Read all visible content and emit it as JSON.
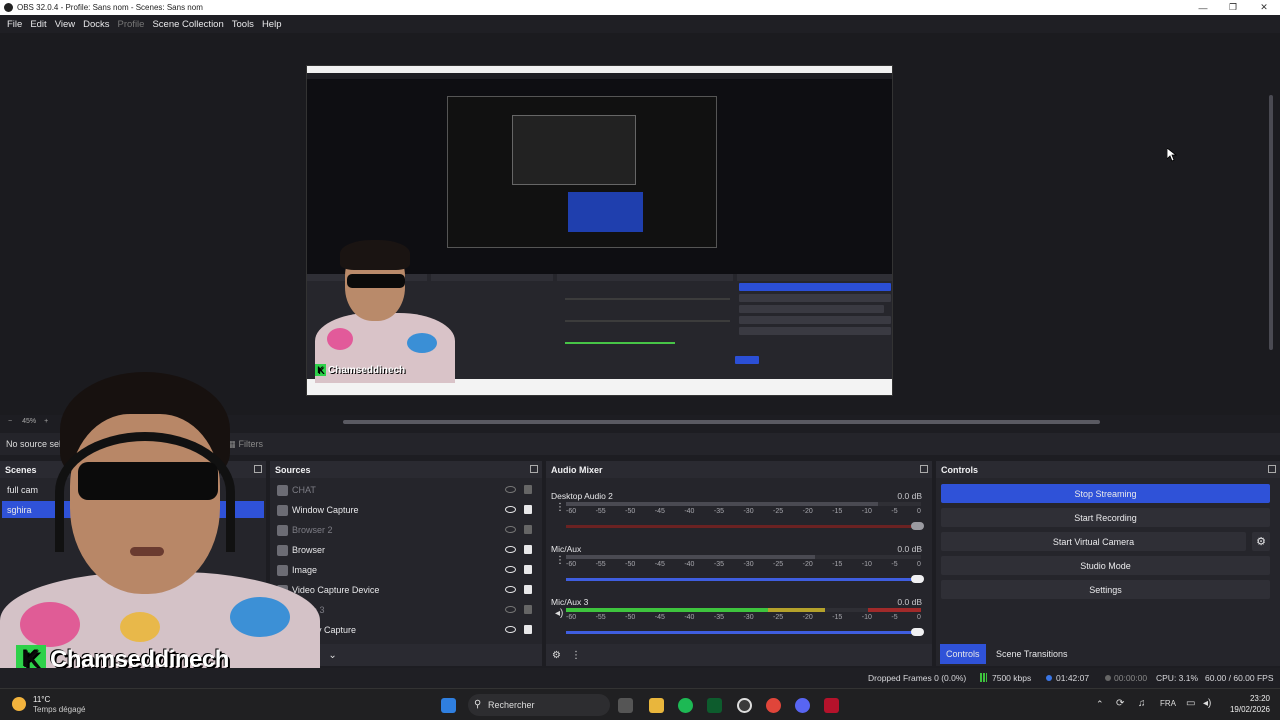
{
  "window": {
    "title": "OBS 32.0.4 - Profile: Sans nom - Scenes: Sans nom"
  },
  "menu": [
    "File",
    "Edit",
    "View",
    "Docks",
    "Profile",
    "Scene Collection",
    "Tools",
    "Help"
  ],
  "preview": {
    "zoom": "45%"
  },
  "source_bar": {
    "no_source": "No source selected",
    "filters": "Filters"
  },
  "scenes": {
    "title": "Scenes",
    "items": [
      {
        "label": "full cam"
      },
      {
        "label": "sghira"
      }
    ]
  },
  "sources": {
    "title": "Sources",
    "items": [
      {
        "label": "CHAT",
        "visible": false
      },
      {
        "label": "Window Capture",
        "visible": true
      },
      {
        "label": "Browser 2",
        "visible": false
      },
      {
        "label": "Browser",
        "visible": true
      },
      {
        "label": "Image",
        "visible": true
      },
      {
        "label": "Video Capture Device",
        "visible": true
      },
      {
        "label": "Image 3",
        "visible": false
      },
      {
        "label": "Display Capture",
        "visible": true
      }
    ]
  },
  "mixer": {
    "title": "Audio Mixer",
    "ticks": [
      "-60",
      "-55",
      "-50",
      "-45",
      "-40",
      "-35",
      "-30",
      "-25",
      "-20",
      "-15",
      "-10",
      "-5",
      "0"
    ],
    "channels": [
      {
        "name": "Desktop Audio 2",
        "db": "0.0 dB",
        "muted": true,
        "volume": 1.0
      },
      {
        "name": "Mic/Aux",
        "db": "0.0 dB",
        "muted": false,
        "volume": 1.0
      },
      {
        "name": "Mic/Aux 3",
        "db": "0.0 dB",
        "muted": false,
        "volume": 1.0
      }
    ]
  },
  "controls": {
    "title": "Controls",
    "stop_streaming": "Stop Streaming",
    "start_recording": "Start Recording",
    "start_virtual_camera": "Start Virtual Camera",
    "studio_mode": "Studio Mode",
    "settings": "Settings",
    "tab_controls": "Controls",
    "tab_transitions": "Scene Transitions"
  },
  "status": {
    "dropped": "Dropped Frames 0 (0.0%)",
    "bitrate": "7500 kbps",
    "stream_time": "01:42:07",
    "rec_time": "00:00:00",
    "cpu": "CPU: 3.1%",
    "fps": "60.00 / 60.00 FPS"
  },
  "taskbar": {
    "weather_temp": "11°C",
    "weather_desc": "Temps dégagé",
    "search": "Rechercher",
    "lang": "FRA",
    "time": "23:20",
    "date": "19/02/2026"
  },
  "webcam": {
    "tag": "Chamseddinech",
    "tag_letter": "K"
  },
  "colors": {
    "accent": "#2f52d8",
    "meter_green": "#3ec43e",
    "meter_yellow": "#b5a22b",
    "meter_red": "#a12a2a"
  }
}
